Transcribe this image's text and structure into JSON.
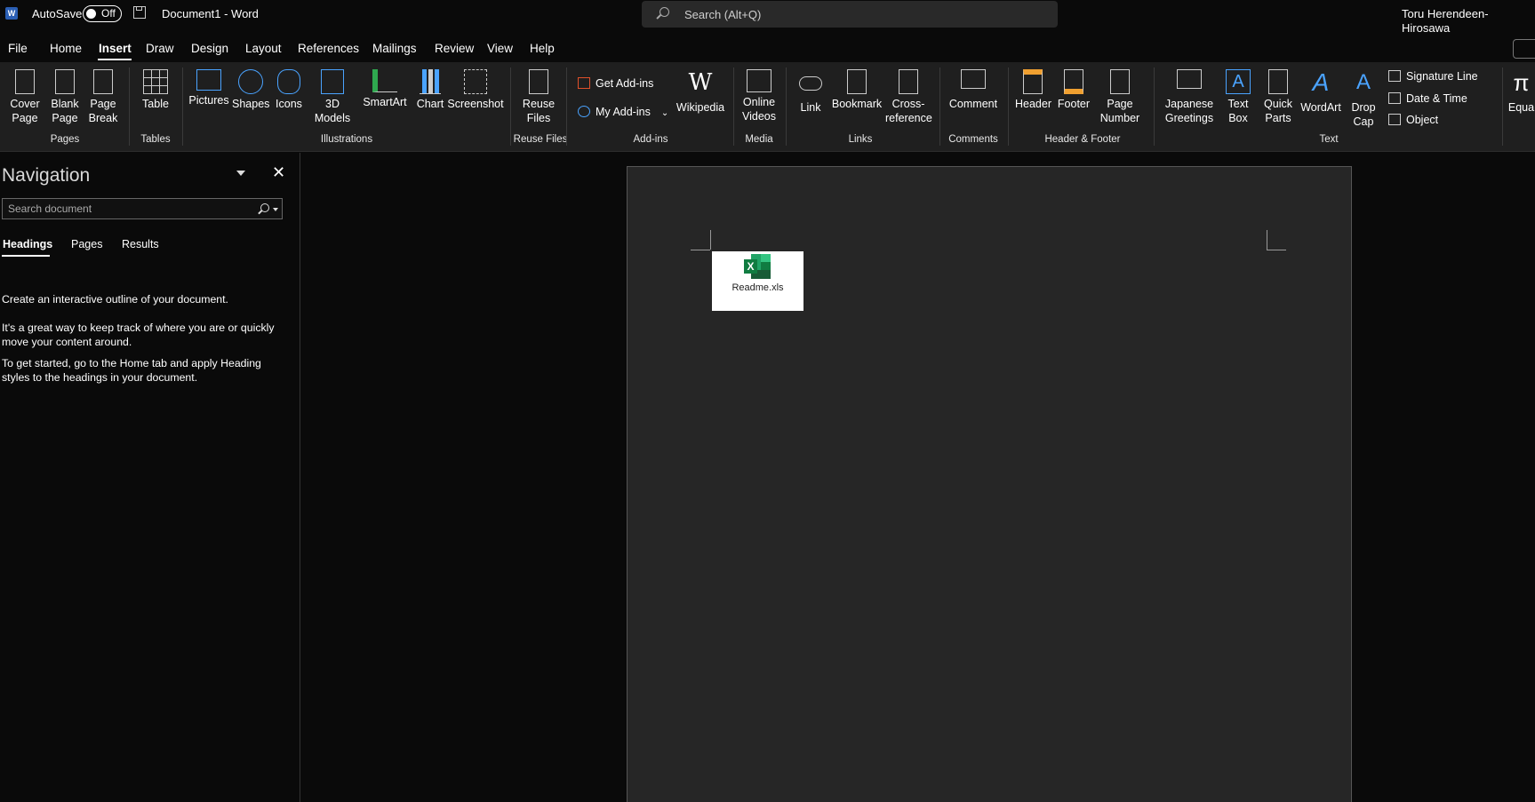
{
  "titlebar": {
    "autosave_label": "AutoSave",
    "toggle_state": "Off",
    "document_title": "Document1  -  Word",
    "search_placeholder": "Search (Alt+Q)",
    "user_name": "Toru Herendeen-Hirosawa"
  },
  "menu": [
    "File",
    "Home",
    "Insert",
    "Draw",
    "Design",
    "Layout",
    "References",
    "Mailings",
    "Review",
    "View",
    "Help"
  ],
  "menu_active": "Insert",
  "ribbon": {
    "cover_page": [
      "Cover",
      "Page"
    ],
    "blank_page": [
      "Blank",
      "Page"
    ],
    "page_break": [
      "Page",
      "Break"
    ],
    "table": "Table",
    "pictures": "Pictures",
    "shapes": "Shapes",
    "icons": "Icons",
    "models_3d": [
      "3D",
      "Models"
    ],
    "smartart": "SmartArt",
    "chart": "Chart",
    "screenshot": "Screenshot",
    "reuse_files": [
      "Reuse",
      "Files"
    ],
    "get_addins": "Get Add-ins",
    "my_addins": "My Add-ins",
    "wikipedia": "Wikipedia",
    "online_videos": [
      "Online",
      "Videos"
    ],
    "link": "Link",
    "bookmark": "Bookmark",
    "cross_reference": [
      "Cross-",
      "reference"
    ],
    "comment": "Comment",
    "header": "Header",
    "footer": "Footer",
    "page_number": [
      "Page",
      "Number"
    ],
    "japanese_greetings": [
      "Japanese",
      "Greetings"
    ],
    "text_box": [
      "Text",
      "Box"
    ],
    "quick_parts": [
      "Quick",
      "Parts"
    ],
    "wordart": "WordArt",
    "drop_cap": [
      "Drop",
      "Cap"
    ],
    "signature_line": "Signature Line",
    "date_time": "Date & Time",
    "object": "Object",
    "equation": "Equa",
    "groups": {
      "pages": "Pages",
      "tables": "Tables",
      "illustrations": "Illustrations",
      "reuse_files": "Reuse Files",
      "addins": "Add-ins",
      "media": "Media",
      "links": "Links",
      "comments": "Comments",
      "header_footer": "Header & Footer",
      "text": "Text"
    }
  },
  "navigation": {
    "title": "Navigation",
    "search_placeholder": "Search document",
    "tabs": [
      "Headings",
      "Pages",
      "Results"
    ],
    "active_tab": "Headings",
    "paragraphs": [
      "Create an interactive outline of your document.",
      "It's a great way to keep track of where you are or quickly move your content around.",
      "To get started, go to the Home tab and apply Heading styles to the headings in your document."
    ]
  },
  "document": {
    "embedded_object_label": "Readme.xls"
  },
  "colors": {
    "excel_green": "#107c41",
    "word_blue": "#2b5fb4",
    "accent_blue": "#4aa3ff",
    "accent_orange": "#f0a030"
  }
}
